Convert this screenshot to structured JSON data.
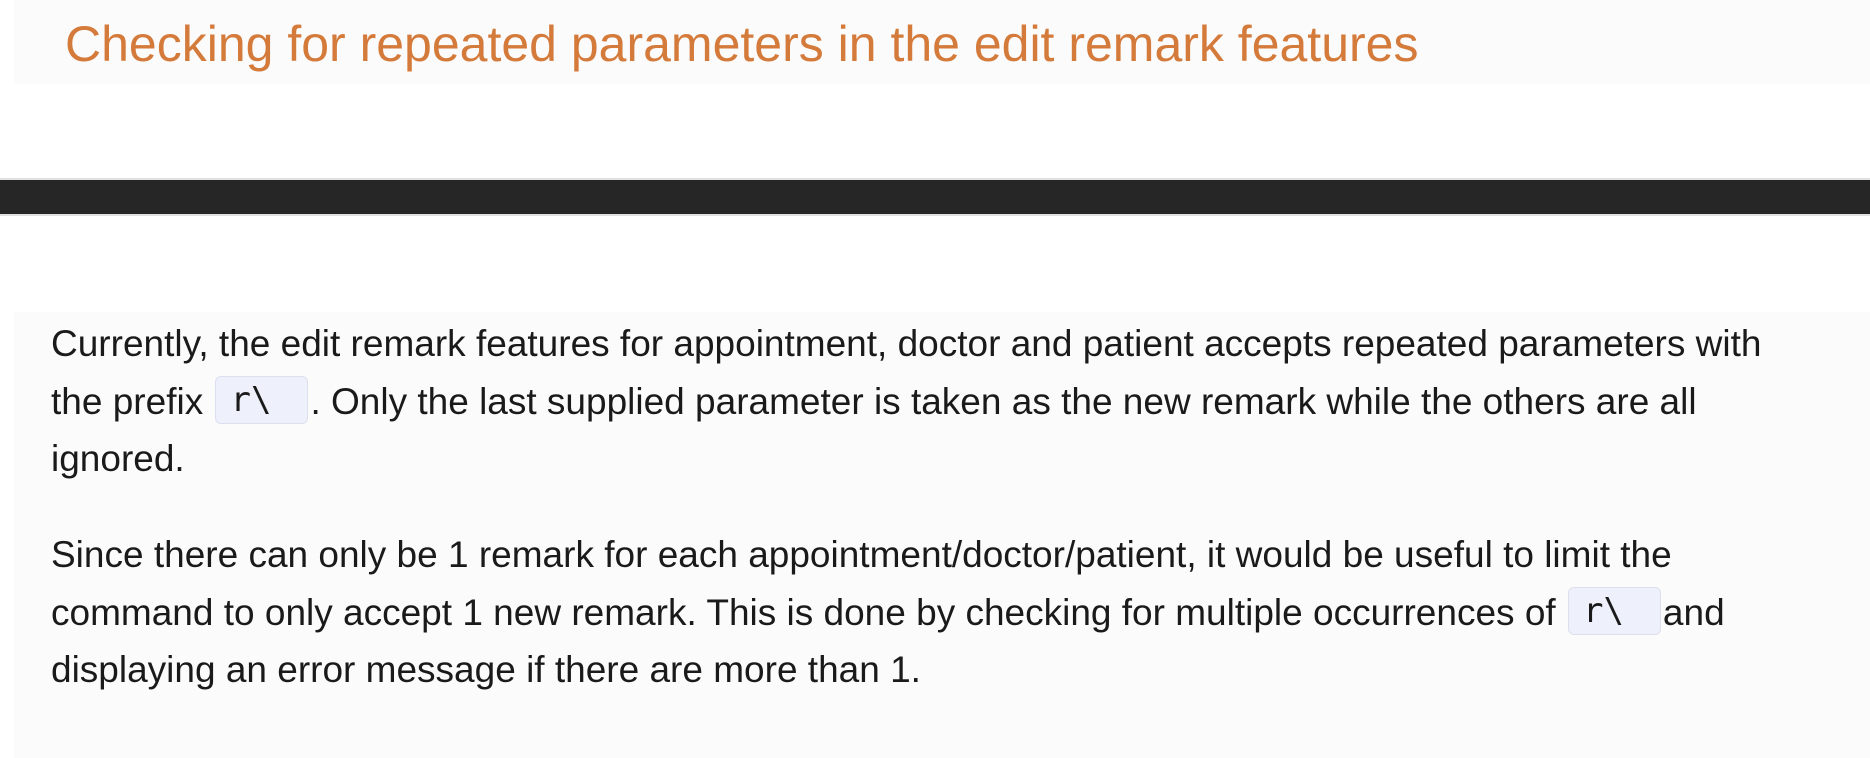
{
  "title": "Checking for repeated parameters in the edit remark features",
  "paragraph_1": {
    "before_code": "Currently, the edit remark features for appointment, doctor and patient accepts repeated parameters with",
    "line_2_prefix": "the prefix",
    "code": "r\\",
    "after_code": ". Only the last supplied parameter is taken as the new remark while the others are all",
    "line_3": "ignored."
  },
  "paragraph_2": {
    "line_1": "Since there can only be 1 remark for each appointment/doctor/patient, it would be useful to limit the",
    "before_code": "command to only accept 1 new remark. This is done by checking for multiple occurrences of",
    "code": "r\\",
    "after_code": "and",
    "line_3": "displaying an error message if there are more than 1."
  },
  "colors": {
    "title": "#d47a3a",
    "bar": "#262626",
    "code_background": "#eef0fb",
    "block_background": "#fbfbfb"
  }
}
